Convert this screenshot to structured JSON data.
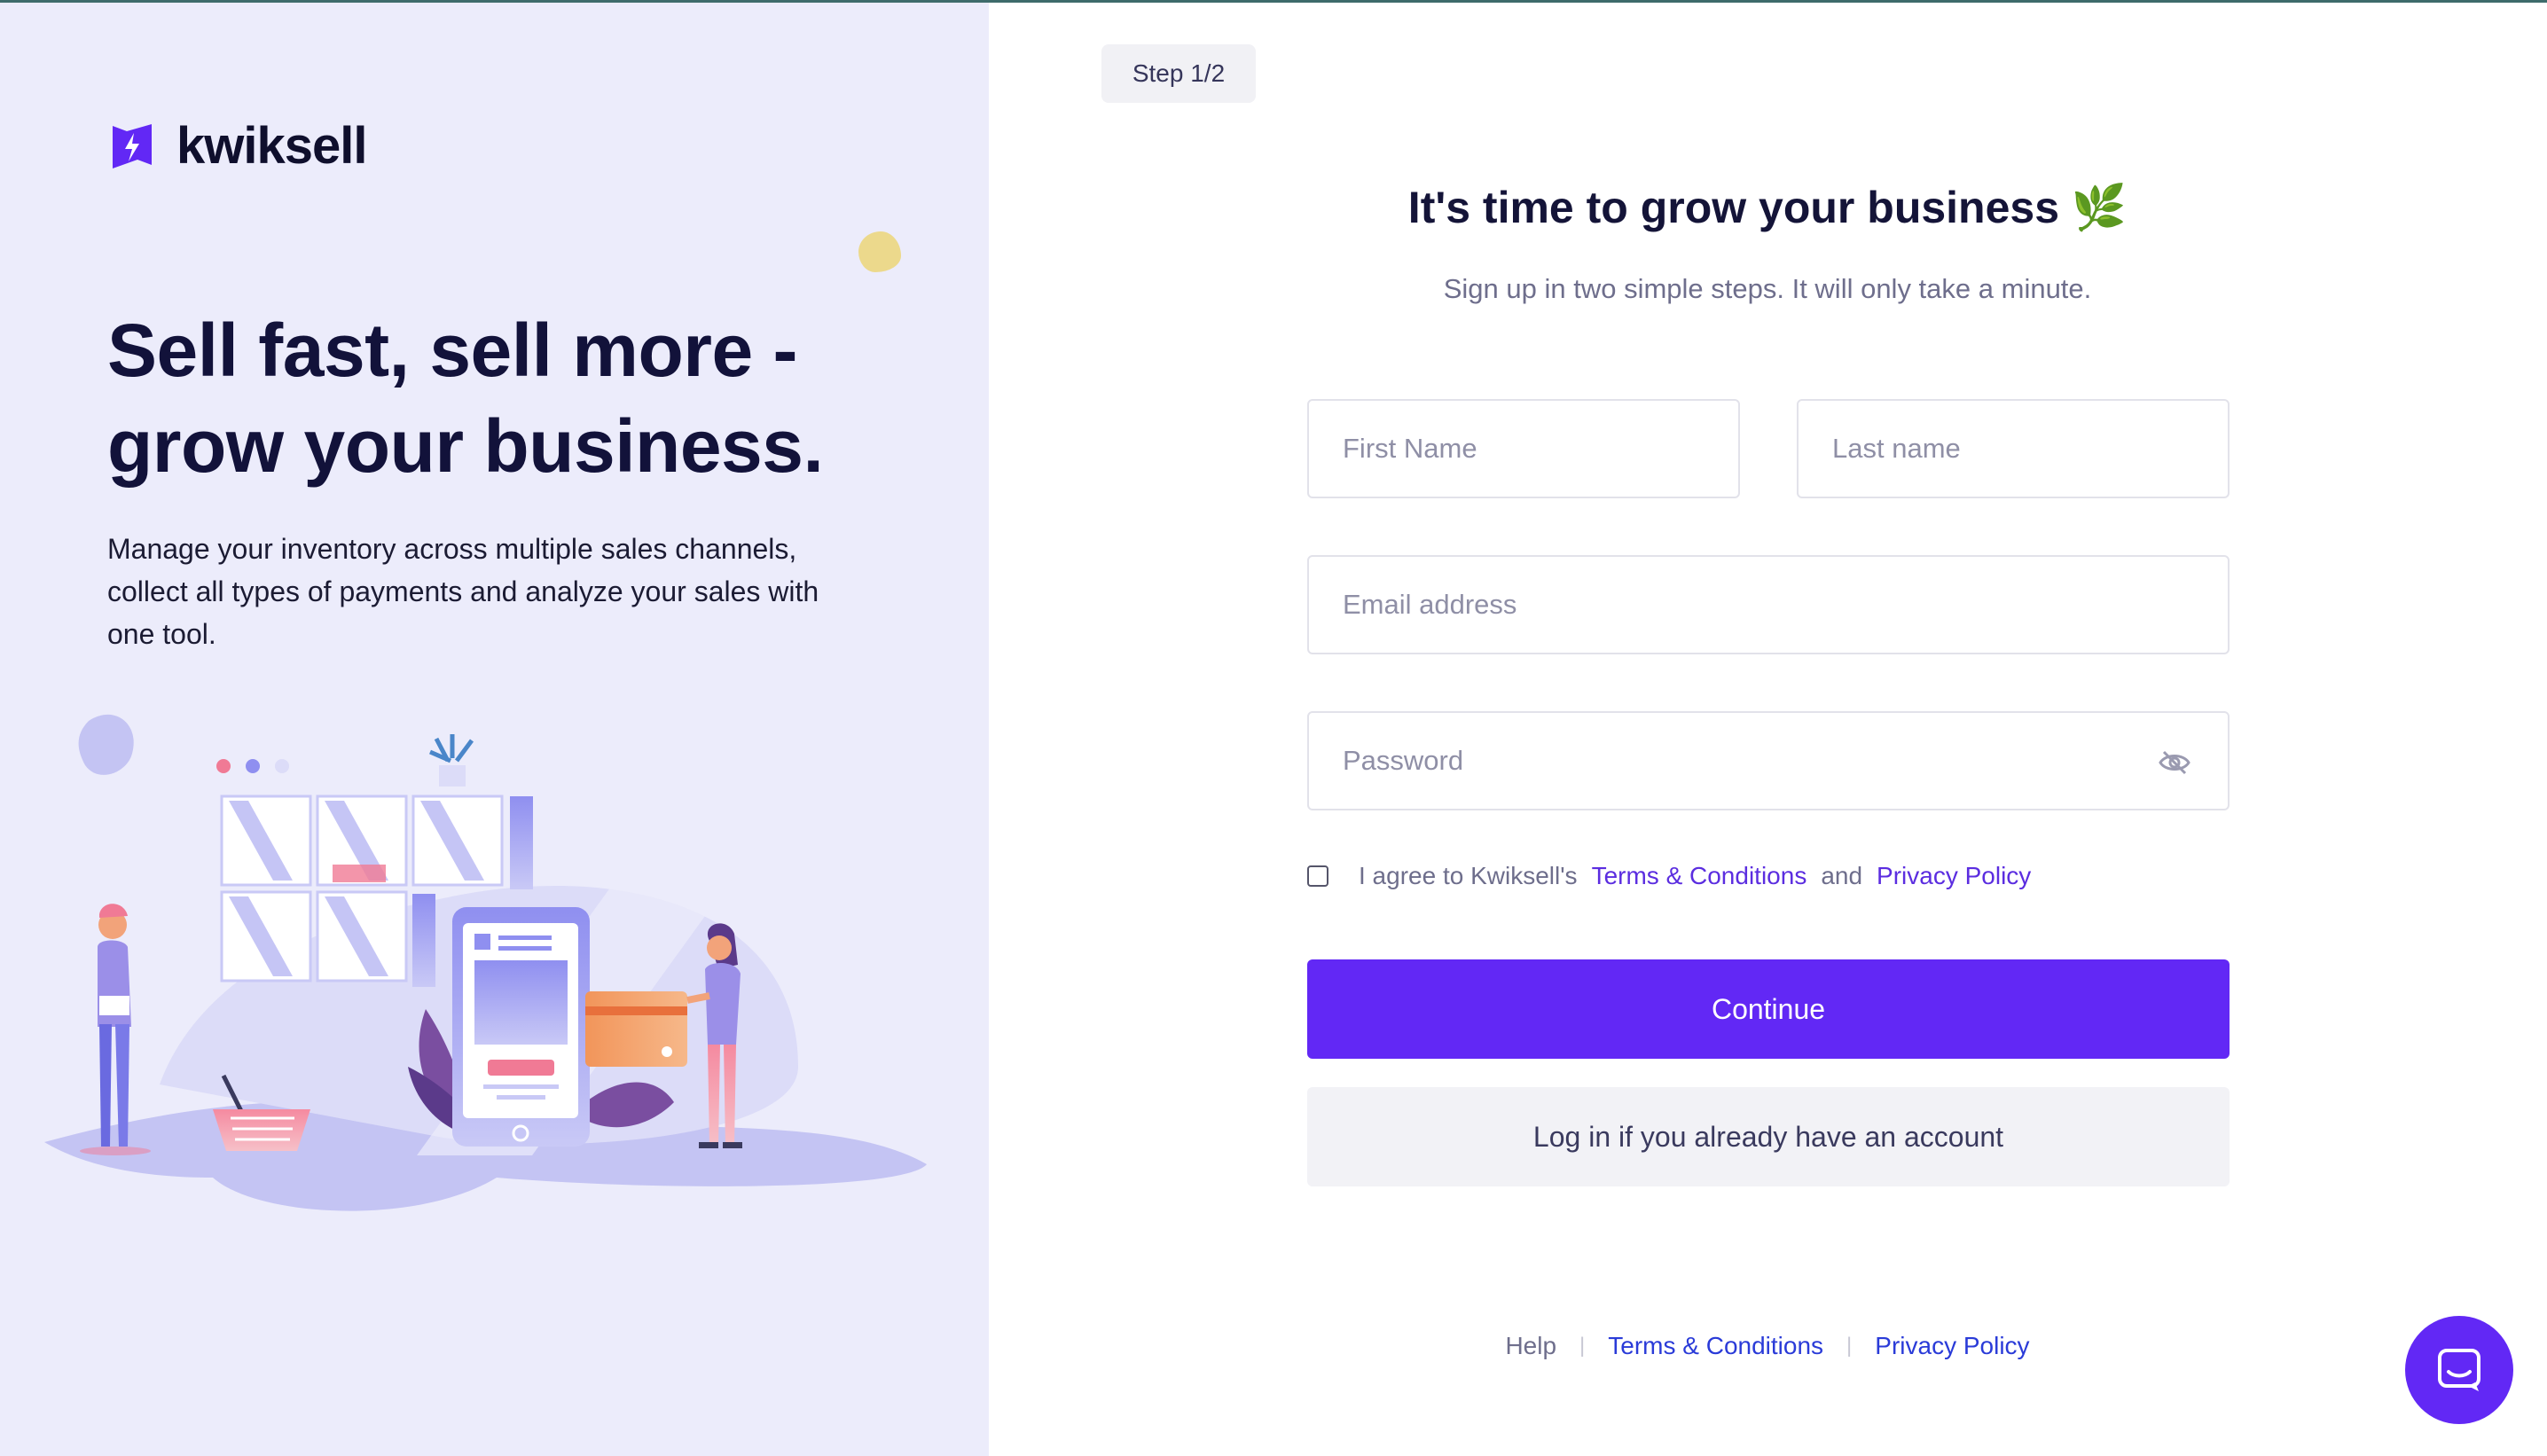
{
  "brand": {
    "name": "kwiksell",
    "accent": "#6228f5",
    "panel_bg": "#ececfb"
  },
  "hero": {
    "title": "Sell fast, sell more - grow your business.",
    "description": "Manage your inventory across multiple sales channels, collect all types of payments and analyze your sales with one tool."
  },
  "step": {
    "label": "Step 1/2"
  },
  "form": {
    "title": "It's time to grow your business 🌿",
    "subtitle": "Sign up in two simple steps. It will only take a minute.",
    "first_name_placeholder": "First Name",
    "last_name_placeholder": "Last name",
    "email_placeholder": "Email address",
    "password_placeholder": "Password",
    "password_toggle_icon": "eye-off-icon",
    "agree_prefix": "I agree to Kwiksell's",
    "agree_terms": "Terms & Conditions",
    "agree_and": "and",
    "agree_privacy": "Privacy Policy",
    "continue_label": "Continue",
    "login_label": "Log in if you already have an account"
  },
  "footer": {
    "help": "Help",
    "terms": "Terms & Conditions",
    "privacy": "Privacy Policy"
  },
  "chat": {
    "icon": "chat-icon"
  }
}
